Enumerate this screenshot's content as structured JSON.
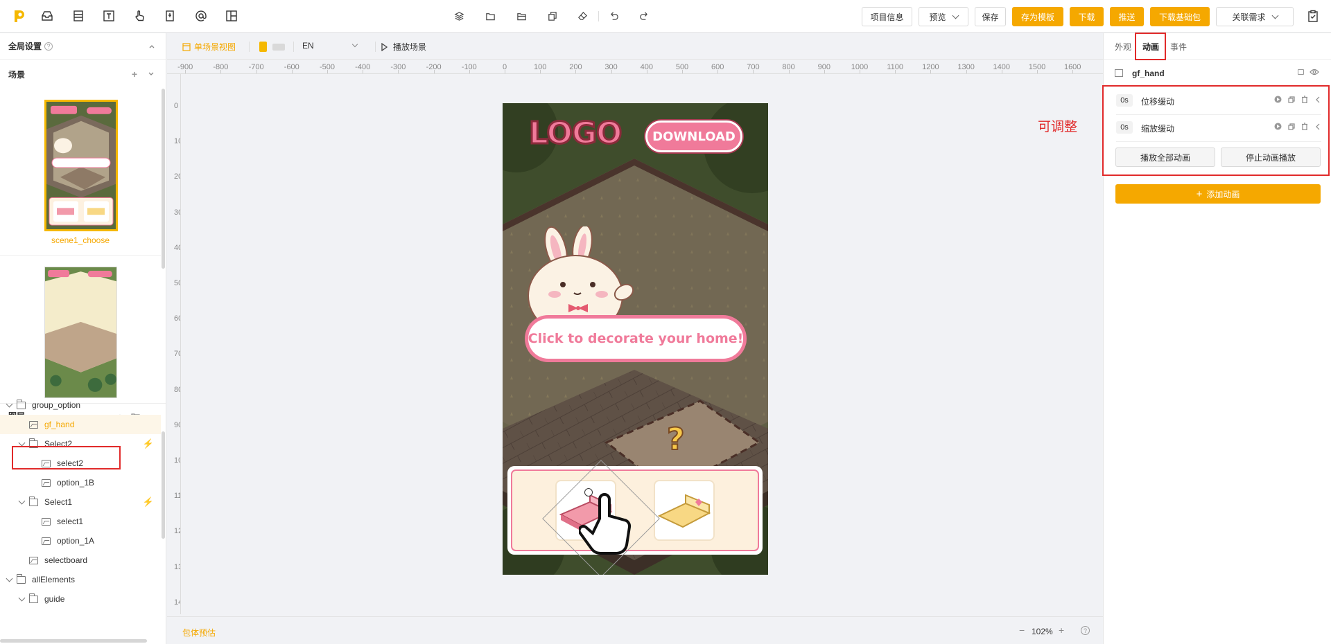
{
  "toolbar": {
    "left_icons": [
      "layers-stack-icon",
      "inbox-icon",
      "text-box-icon",
      "text-tool-icon",
      "hand-pointer-icon",
      "mobile-frame-icon",
      "at-sign-icon",
      "layout-icon"
    ],
    "mid_icons": [
      "layers-icon",
      "folder-icon",
      "folder-open-icon",
      "copy-icon",
      "eraser-icon",
      "undo-icon",
      "redo-icon"
    ],
    "project_info": "项目信息",
    "preview": "预览",
    "save": "保存",
    "save_template": "存为模板",
    "download": "下载",
    "push": "推送",
    "download_base": "下载基础包",
    "related": "关联需求"
  },
  "left": {
    "global_settings": "全局设置",
    "scenes_title": "场景",
    "scenes": [
      {
        "caption": "scene1_choose",
        "selected": true
      },
      {
        "caption": "",
        "selected": false
      }
    ],
    "layers_title": "图层",
    "layers": [
      {
        "name": "group_option",
        "type": "folder",
        "level": 0,
        "expanded": true,
        "active": false,
        "bolt": false
      },
      {
        "name": "gf_hand",
        "type": "image",
        "level": 1,
        "active": true,
        "bolt": false
      },
      {
        "name": "Select2",
        "type": "folder",
        "level": 1,
        "expanded": true,
        "active": false,
        "bolt": true
      },
      {
        "name": "select2",
        "type": "image",
        "level": 2,
        "active": false,
        "bolt": false
      },
      {
        "name": "option_1B",
        "type": "image",
        "level": 2,
        "active": false,
        "bolt": false
      },
      {
        "name": "Select1",
        "type": "folder",
        "level": 1,
        "expanded": true,
        "active": false,
        "bolt": true
      },
      {
        "name": "select1",
        "type": "image",
        "level": 2,
        "active": false,
        "bolt": false
      },
      {
        "name": "option_1A",
        "type": "image",
        "level": 2,
        "active": false,
        "bolt": false
      },
      {
        "name": "selectboard",
        "type": "image",
        "level": 1,
        "active": false,
        "bolt": false
      },
      {
        "name": "allElements",
        "type": "folder",
        "level": 0,
        "expanded": true,
        "active": false,
        "bolt": false
      },
      {
        "name": "guide",
        "type": "folder",
        "level": 1,
        "expanded": true,
        "active": false,
        "bolt": false
      }
    ]
  },
  "center": {
    "single_scene_view": "单场景视图",
    "language": "EN",
    "play_scene": "播放场景",
    "ruler_h": [
      "-1000",
      "-900",
      "-800",
      "-700",
      "-600",
      "-500",
      "-400",
      "-300",
      "-200",
      "-100",
      "0",
      "100",
      "200",
      "300",
      "400",
      "500",
      "600",
      "700",
      "800",
      "900",
      "1000",
      "1100",
      "1200",
      "1300",
      "1400",
      "1500",
      "1600"
    ],
    "ruler_v": [
      "0",
      "100",
      "200",
      "300",
      "400",
      "500",
      "600",
      "700",
      "800",
      "900",
      "1000",
      "1100",
      "1200",
      "1300",
      "1400"
    ],
    "bundle_estimate": "包体预估",
    "zoom": "102%"
  },
  "canvas": {
    "logo": "LOGO",
    "download": "DOWNLOAD",
    "prompt": "Click to decorate your home!",
    "question": "?"
  },
  "right": {
    "tabs": [
      "外观",
      "动画",
      "事件"
    ],
    "active_tab": 1,
    "element_name": "gf_hand",
    "animations": [
      {
        "time": "0s",
        "label": "位移缓动"
      },
      {
        "time": "0s",
        "label": "缩放缓动"
      }
    ],
    "play_all": "播放全部动画",
    "stop_all": "停止动画播放",
    "add_animation": "添加动画",
    "annotation": "可调整"
  },
  "colors": {
    "accent": "#f5a800",
    "highlight_red": "#e12a2a",
    "pink": "#f07a9a"
  }
}
